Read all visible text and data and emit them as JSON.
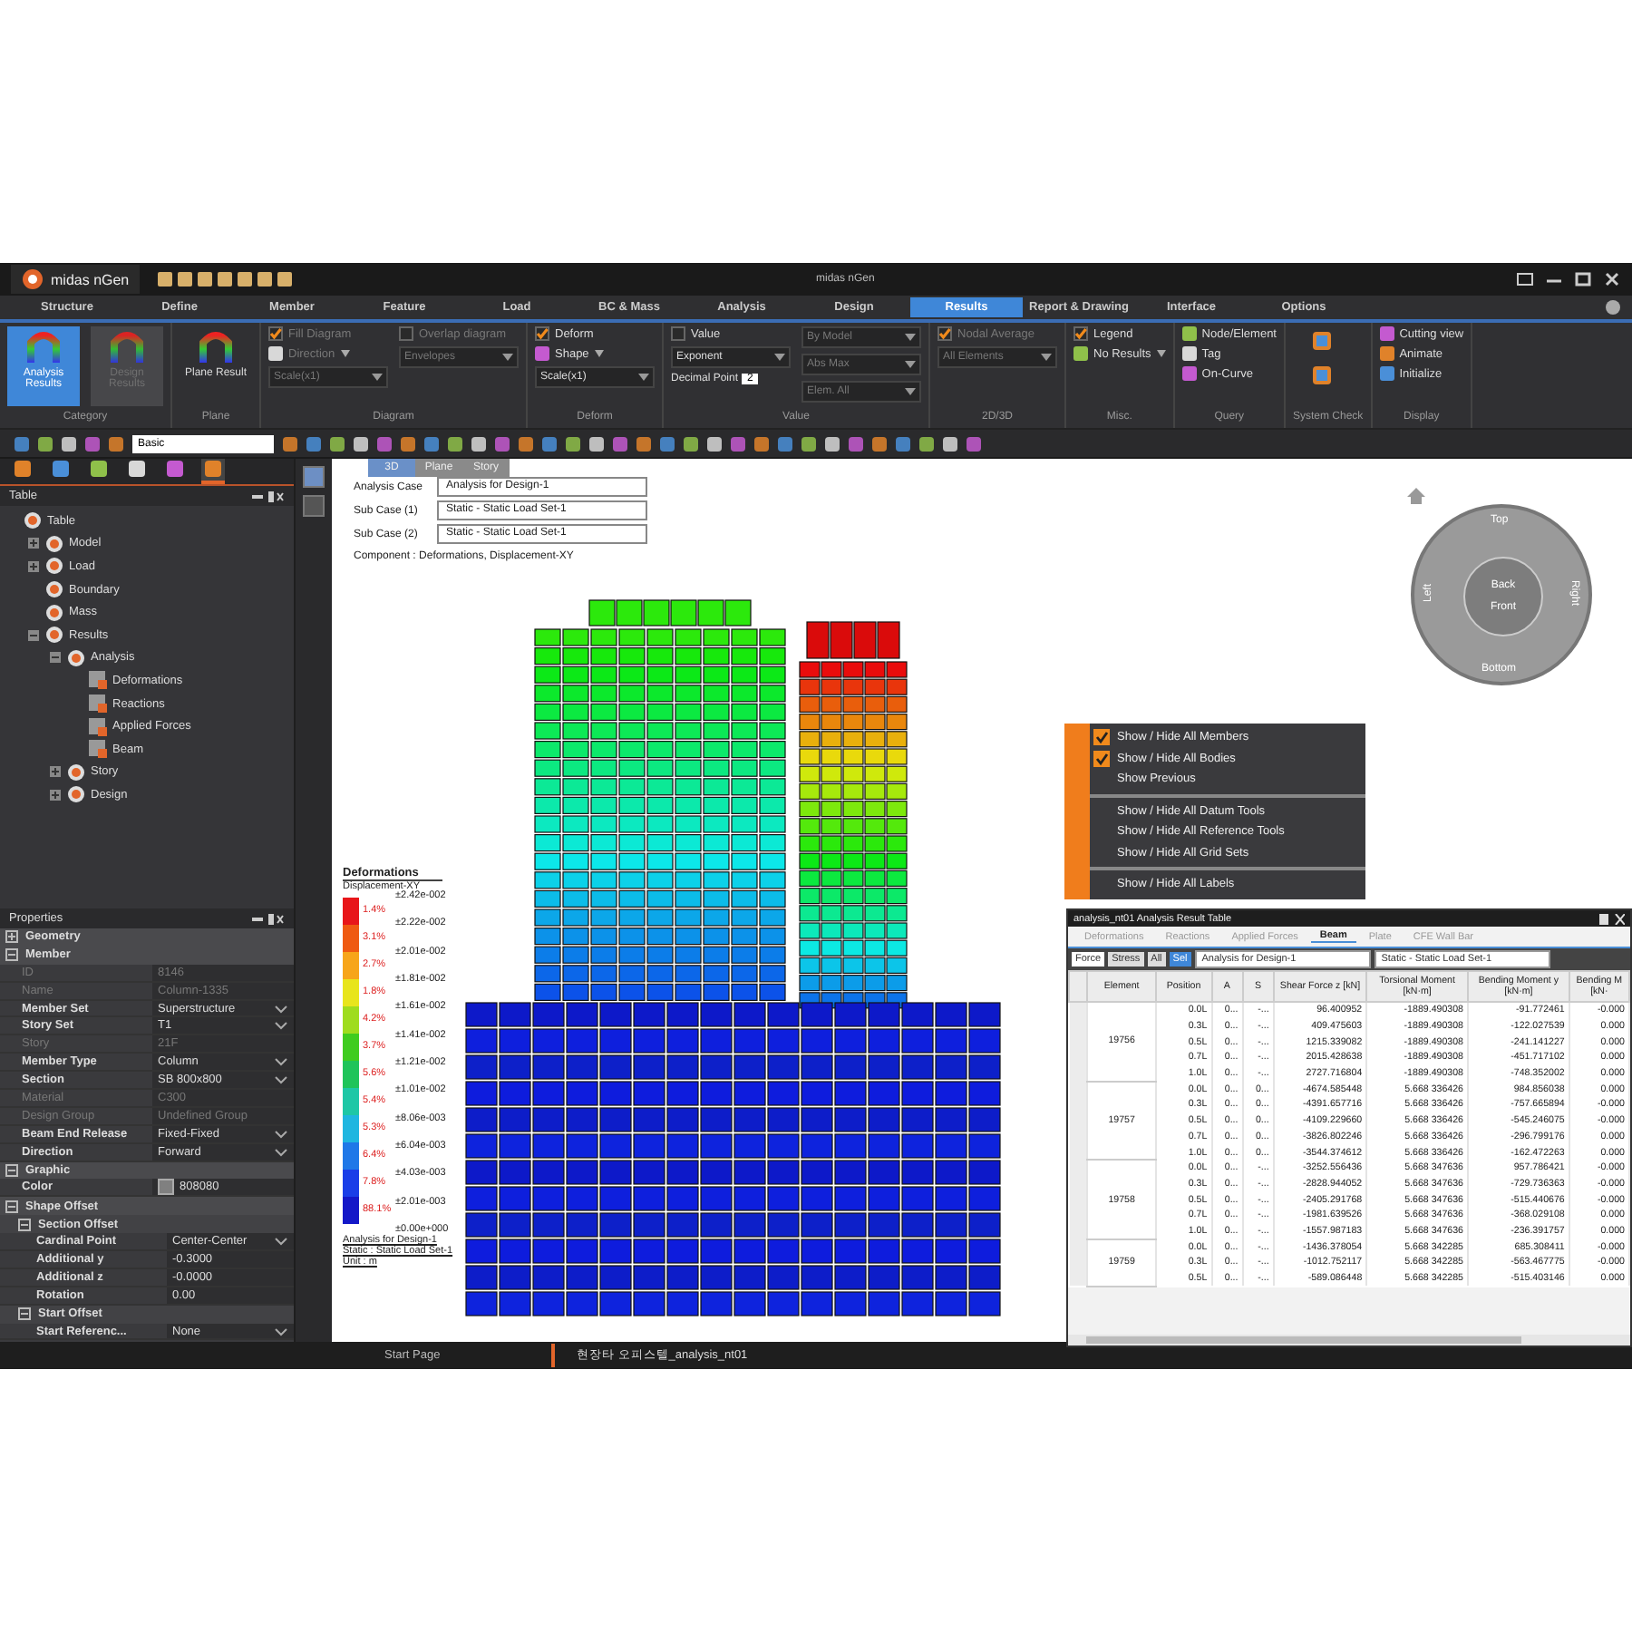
{
  "titlebar": {
    "app": "midas nGen",
    "title": "midas nGen"
  },
  "ribbon_tabs": [
    {
      "label": "Structure",
      "selected": false
    },
    {
      "label": "Define",
      "selected": false
    },
    {
      "label": "Member",
      "selected": false
    },
    {
      "label": "Feature",
      "selected": false
    },
    {
      "label": "Load",
      "selected": false
    },
    {
      "label": "BC & Mass",
      "selected": false
    },
    {
      "label": "Analysis",
      "selected": false
    },
    {
      "label": "Design",
      "selected": false
    },
    {
      "label": "Results",
      "selected": true
    },
    {
      "label": "Report & Drawing",
      "selected": false
    },
    {
      "label": "Interface",
      "selected": false
    },
    {
      "label": "Options",
      "selected": false
    }
  ],
  "ribbon_groups": [
    {
      "caption": "Category",
      "columns": [
        [
          {
            "kind": "big",
            "label": "Analysis Results",
            "selected": true,
            "disabled": false
          }
        ],
        [
          {
            "kind": "big",
            "label": "Design Results",
            "selected": false,
            "disabled": true
          }
        ]
      ]
    },
    {
      "caption": "Plane",
      "columns": [
        [
          {
            "kind": "big",
            "label": "Plane Result",
            "selected": false,
            "disabled": false
          }
        ]
      ]
    },
    {
      "caption": "Diagram",
      "columns": [
        [
          {
            "kind": "check",
            "label": "Fill Diagram",
            "checked": true,
            "disabled": true
          },
          {
            "kind": "button",
            "label": "Direction",
            "dropdown": true,
            "disabled": true
          },
          {
            "kind": "select",
            "value": "Scale(x1)",
            "disabled": true
          }
        ],
        [
          {
            "kind": "check",
            "label": "Overlap diagram",
            "checked": false,
            "disabled": true
          },
          {
            "kind": "select",
            "value": "Envelopes",
            "disabled": true
          }
        ]
      ]
    },
    {
      "caption": "Deform",
      "columns": [
        [
          {
            "kind": "check",
            "label": "Deform",
            "checked": true,
            "disabled": false
          },
          {
            "kind": "button",
            "label": "Shape",
            "dropdown": true,
            "disabled": false
          },
          {
            "kind": "select",
            "value": "Scale(x1)",
            "disabled": false
          }
        ]
      ]
    },
    {
      "caption": "Value",
      "columns": [
        [
          {
            "kind": "check",
            "label": "Value",
            "checked": false,
            "disabled": false
          },
          {
            "kind": "select",
            "value": "Exponent",
            "disabled": false
          },
          {
            "kind": "spin",
            "label": "Decimal Point",
            "value": "2",
            "disabled": false
          }
        ],
        [
          {
            "kind": "select",
            "value": "By Model",
            "disabled": true
          },
          {
            "kind": "select",
            "value": "Abs Max",
            "disabled": true
          },
          {
            "kind": "select",
            "value": "Elem. All",
            "disabled": true
          }
        ]
      ]
    },
    {
      "caption": "2D/3D",
      "columns": [
        [
          {
            "kind": "check",
            "label": "Nodal Average",
            "checked": true,
            "disabled": true
          },
          {
            "kind": "select",
            "value": "All Elements",
            "disabled": true
          }
        ]
      ]
    },
    {
      "caption": "Misc.",
      "columns": [
        [
          {
            "kind": "check",
            "label": "Legend",
            "checked": true,
            "disabled": false
          },
          {
            "kind": "button",
            "label": "No Results",
            "dropdown": true,
            "disabled": false
          }
        ]
      ]
    },
    {
      "caption": "Query",
      "columns": [
        [
          {
            "kind": "button",
            "label": "Node/Element",
            "dropdown": false,
            "disabled": false
          },
          {
            "kind": "button",
            "label": "Tag",
            "dropdown": false,
            "disabled": false
          },
          {
            "kind": "button",
            "label": "On-Curve",
            "dropdown": false,
            "disabled": false
          }
        ]
      ]
    },
    {
      "caption": "System Check",
      "columns": [
        [
          {
            "kind": "icon",
            "disabled": false
          },
          {
            "kind": "icon",
            "disabled": false
          }
        ]
      ]
    },
    {
      "caption": "Display",
      "columns": [
        [
          {
            "kind": "button",
            "label": "Cutting view",
            "dropdown": false,
            "disabled": false
          },
          {
            "kind": "button",
            "label": "Animate",
            "dropdown": false,
            "disabled": false
          },
          {
            "kind": "button",
            "label": "Initialize",
            "dropdown": false,
            "disabled": false
          }
        ]
      ]
    }
  ],
  "toolbar": {
    "filter_value": "Basic"
  },
  "panel_tabs": [
    {
      "selected": false
    },
    {
      "selected": false
    },
    {
      "selected": false
    },
    {
      "selected": false
    },
    {
      "selected": false
    },
    {
      "selected": true
    }
  ],
  "table_panel": {
    "title": "Table",
    "tree": [
      {
        "label": "Table",
        "kind": "root",
        "children": [
          {
            "label": "Model",
            "kind": "group",
            "expanded": false
          },
          {
            "label": "Load",
            "kind": "group",
            "expanded": false
          },
          {
            "label": "Boundary",
            "kind": "node"
          },
          {
            "label": "Mass",
            "kind": "node"
          },
          {
            "label": "Results",
            "kind": "group",
            "expanded": true,
            "children": [
              {
                "label": "Analysis",
                "kind": "group",
                "expanded": true,
                "children": [
                  {
                    "label": "Deformations",
                    "kind": "table"
                  },
                  {
                    "label": "Reactions",
                    "kind": "table"
                  },
                  {
                    "label": "Applied Forces",
                    "kind": "table"
                  },
                  {
                    "label": "Beam",
                    "kind": "table"
                  }
                ]
              },
              {
                "label": "Story",
                "kind": "group",
                "expanded": false
              },
              {
                "label": "Design",
                "kind": "group",
                "expanded": false
              }
            ]
          }
        ]
      }
    ]
  },
  "properties": {
    "title": "Properties",
    "rows": [
      {
        "kind": "section",
        "label": "Geometry",
        "expanded": false
      },
      {
        "kind": "section",
        "label": "Member",
        "expanded": true
      },
      {
        "kind": "prop",
        "name": "ID",
        "value": "8146",
        "disabled": true,
        "dropdown": false
      },
      {
        "kind": "prop",
        "name": "Name",
        "value": "Column-1335",
        "disabled": true,
        "dropdown": false
      },
      {
        "kind": "prop",
        "name": "Member Set",
        "value": "Superstructure",
        "disabled": false,
        "dropdown": true
      },
      {
        "kind": "prop",
        "name": "Story Set",
        "value": "T1",
        "disabled": false,
        "dropdown": true
      },
      {
        "kind": "prop",
        "name": "Story",
        "value": "21F",
        "disabled": true,
        "dropdown": false
      },
      {
        "kind": "prop",
        "name": "Member Type",
        "value": "Column",
        "disabled": false,
        "dropdown": true
      },
      {
        "kind": "prop",
        "name": "Section",
        "value": "SB 800x800",
        "disabled": false,
        "dropdown": true
      },
      {
        "kind": "prop",
        "name": "Material",
        "value": "C300",
        "disabled": true,
        "dropdown": false
      },
      {
        "kind": "prop",
        "name": "Design Group",
        "value": "Undefined Group",
        "disabled": true,
        "dropdown": false
      },
      {
        "kind": "prop",
        "name": "Beam End Release",
        "value": "Fixed-Fixed",
        "disabled": false,
        "dropdown": true
      },
      {
        "kind": "prop",
        "name": "Direction",
        "value": "Forward",
        "disabled": false,
        "dropdown": true
      },
      {
        "kind": "section",
        "label": "Graphic",
        "expanded": true
      },
      {
        "kind": "prop",
        "name": "Color",
        "value": "808080",
        "disabled": false,
        "dropdown": false,
        "color": "#808080"
      },
      {
        "kind": "section",
        "label": "Shape Offset",
        "expanded": true
      },
      {
        "kind": "subsection",
        "label": "Section Offset",
        "expanded": true
      },
      {
        "kind": "prop",
        "name": "Cardinal Point",
        "value": "Center-Center",
        "disabled": false,
        "dropdown": true,
        "indent": true
      },
      {
        "kind": "prop",
        "name": "Additional y",
        "value": "-0.3000",
        "disabled": false,
        "dropdown": false,
        "indent": true
      },
      {
        "kind": "prop",
        "name": "Additional z",
        "value": "-0.0000",
        "disabled": false,
        "dropdown": false,
        "indent": true
      },
      {
        "kind": "prop",
        "name": "Rotation",
        "value": "0.00",
        "disabled": false,
        "dropdown": false,
        "indent": true
      },
      {
        "kind": "subsection",
        "label": "Start Offset",
        "expanded": true
      },
      {
        "kind": "prop",
        "name": "Start Referenc...",
        "value": "None",
        "disabled": false,
        "dropdown": true,
        "indent": true
      }
    ]
  },
  "viewport": {
    "tabs": [
      {
        "label": "3D",
        "selected": true
      },
      {
        "label": "Plane",
        "selected": false
      },
      {
        "label": "Story",
        "selected": false
      }
    ],
    "cases": [
      {
        "label": "Analysis Case",
        "value": "Analysis for Design-1"
      },
      {
        "label": "Sub Case (1)",
        "value": "Static - Static Load Set-1"
      },
      {
        "label": "Sub Case (2)",
        "value": "Static - Static Load Set-1"
      }
    ],
    "component": "Component : Deformations, Displacement-XY",
    "legend": {
      "title": "Deformations",
      "subtitle": "Displacement-XY",
      "bands": [
        {
          "color": "#e8161a",
          "percent": "1.4%"
        },
        {
          "color": "#ef5a12",
          "percent": "3.1%"
        },
        {
          "color": "#f7a51a",
          "percent": "2.7%"
        },
        {
          "color": "#e8e51c",
          "percent": "1.8%"
        },
        {
          "color": "#9fdc1e",
          "percent": "4.2%"
        },
        {
          "color": "#3fcc1f",
          "percent": "3.7%"
        },
        {
          "color": "#1fc45a",
          "percent": "5.6%"
        },
        {
          "color": "#1ec7a6",
          "percent": "5.4%"
        },
        {
          "color": "#1fb6e0",
          "percent": "5.3%"
        },
        {
          "color": "#1f78e8",
          "percent": "6.4%"
        },
        {
          "color": "#1a3ee8",
          "percent": "7.8%"
        },
        {
          "color": "#1418c8",
          "percent": "88.1%"
        }
      ],
      "values": [
        "±2.42e-002",
        "±2.22e-002",
        "±2.01e-002",
        "±1.81e-002",
        "±1.61e-002",
        "±1.41e-002",
        "±1.21e-002",
        "±1.01e-002",
        "±8.06e-003",
        "±6.04e-003",
        "±4.03e-003",
        "±2.01e-003",
        "±0.00e+000"
      ],
      "footer": [
        "Analysis for Design-1",
        "Static : Static Load Set-1",
        "Unit : m"
      ]
    },
    "view_cube": {
      "top": "Top",
      "bottom": "Bottom",
      "left": "Left",
      "right": "Right",
      "back": "Back",
      "front": "Front"
    },
    "context_menu": [
      {
        "kind": "item",
        "label": "Show / Hide All Members",
        "checked": true
      },
      {
        "kind": "item",
        "label": "Show / Hide All Bodies",
        "checked": true
      },
      {
        "kind": "item",
        "label": "Show Previous",
        "checked": false
      },
      {
        "kind": "separator"
      },
      {
        "kind": "item",
        "label": "Show / Hide All Datum Tools",
        "checked": false
      },
      {
        "kind": "item",
        "label": "Show / Hide All Reference Tools",
        "checked": false
      },
      {
        "kind": "item",
        "label": "Show / Hide All Grid Sets",
        "checked": false
      },
      {
        "kind": "separator"
      },
      {
        "kind": "item",
        "label": "Show / Hide All Labels",
        "checked": false
      }
    ]
  },
  "result_table": {
    "title": "analysis_nt01 Analysis Result Table",
    "tabs": [
      {
        "label": "Deformations",
        "selected": false
      },
      {
        "label": "Reactions",
        "selected": false
      },
      {
        "label": "Applied Forces",
        "selected": false
      },
      {
        "label": "Beam",
        "selected": true
      },
      {
        "label": "Plate",
        "selected": false
      },
      {
        "label": "CFE Wall Bar",
        "selected": false
      }
    ],
    "modes": [
      {
        "label": "Force",
        "selected": true
      },
      {
        "label": "Stress",
        "selected": false
      }
    ],
    "filters": [
      {
        "label": "All",
        "selected": false
      },
      {
        "label": "Sel",
        "selected": true
      }
    ],
    "case": "Analysis for Design-1",
    "sub_case": "Static - Static Load Set-1",
    "columns": [
      "Element",
      "Position",
      "A",
      "S",
      "Shear Force z [kN]",
      "Torsional Moment [kN·m]",
      "Bending Moment y [kN·m]",
      "Bending M [kN·"
    ],
    "groups": [
      {
        "element": "19756",
        "rows": [
          [
            "0.0L",
            "0...",
            "-...",
            "96.400952",
            "-1889.490308",
            "-91.772461",
            "-0.000"
          ],
          [
            "0.3L",
            "0...",
            "-...",
            "409.475603",
            "-1889.490308",
            "-122.027539",
            "0.000"
          ],
          [
            "0.5L",
            "0...",
            "-...",
            "1215.339082",
            "-1889.490308",
            "-241.141227",
            "0.000"
          ],
          [
            "0.7L",
            "0...",
            "-...",
            "2015.428638",
            "-1889.490308",
            "-451.717102",
            "0.000"
          ],
          [
            "1.0L",
            "0...",
            "-...",
            "2727.716804",
            "-1889.490308",
            "-748.352002",
            "0.000"
          ]
        ]
      },
      {
        "element": "19757",
        "rows": [
          [
            "0.0L",
            "0...",
            "0...",
            "-4674.585448",
            "5.668 336426",
            "984.856038",
            "0.000"
          ],
          [
            "0.3L",
            "0...",
            "0...",
            "-4391.657716",
            "5.668 336426",
            "-757.665894",
            "-0.000"
          ],
          [
            "0.5L",
            "0...",
            "0...",
            "-4109.229660",
            "5.668 336426",
            "-545.246075",
            "-0.000"
          ],
          [
            "0.7L",
            "0...",
            "0...",
            "-3826.802246",
            "5.668 336426",
            "-296.799176",
            "0.000"
          ],
          [
            "1.0L",
            "0...",
            "0...",
            "-3544.374612",
            "5.668 336426",
            "-162.472263",
            "0.000"
          ]
        ]
      },
      {
        "element": "19758",
        "rows": [
          [
            "0.0L",
            "0...",
            "-...",
            "-3252.556436",
            "5.668 347636",
            "957.786421",
            "-0.000"
          ],
          [
            "0.3L",
            "0...",
            "-...",
            "-2828.944052",
            "5.668 347636",
            "-729.736363",
            "-0.000"
          ],
          [
            "0.5L",
            "0...",
            "-...",
            "-2405.291768",
            "5.668 347636",
            "-515.440676",
            "-0.000"
          ],
          [
            "0.7L",
            "0...",
            "-...",
            "-1981.639526",
            "5.668 347636",
            "-368.029108",
            "0.000"
          ],
          [
            "1.0L",
            "0...",
            "-...",
            "-1557.987183",
            "5.668 347636",
            "-236.391757",
            "0.000"
          ]
        ]
      },
      {
        "element": "19759",
        "rows": [
          [
            "0.0L",
            "0...",
            "-...",
            "-1436.378054",
            "5.668 342285",
            "685.308411",
            "-0.000"
          ],
          [
            "0.3L",
            "0...",
            "-...",
            "-1012.752117",
            "5.668 342285",
            "-563.467775",
            "-0.000"
          ],
          [
            "0.5L",
            "0...",
            "-...",
            "-589.086448",
            "5.668 342285",
            "-515.403146",
            "0.000"
          ]
        ]
      }
    ]
  },
  "document_tabs": [
    {
      "label": "Start Page",
      "selected": false
    },
    {
      "label": "현장타 오피스텔_analysis_nt01",
      "selected": true
    }
  ]
}
